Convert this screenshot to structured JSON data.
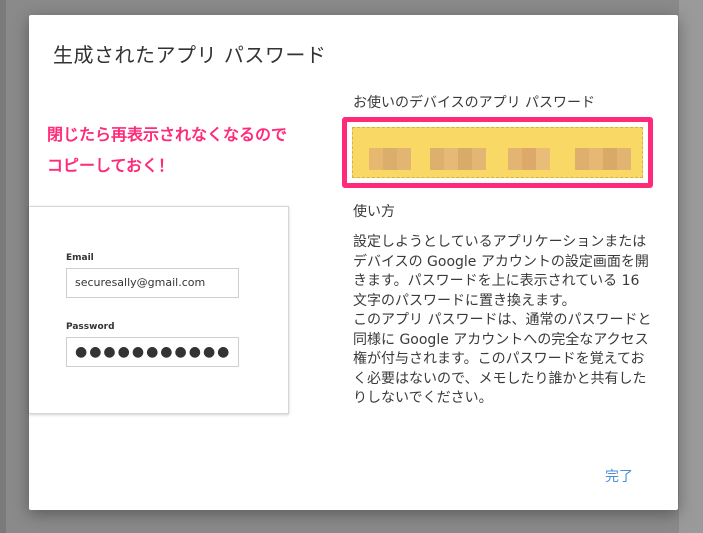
{
  "dialog": {
    "title": "生成されたアプリ パスワード",
    "device_password_heading": "お使いのデバイスのアプリ パスワード",
    "masked_password": "••••••••••••••••",
    "usage_heading": "使い方",
    "instructions": "設定しようとしているアプリケーションまたはデバイスの Google アカウントの設定画面を開きます。パスワードを上に表示されている 16 文字のパスワードに置き換えます。\nこのアプリ パスワードは、通常のパスワードと同様に Google アカウントへの完全なアクセス権が付与されます。このパスワードを覚えておく必要はないので、メモしたり誰かと共有したりしないでください。",
    "done_label": "完了"
  },
  "annotation": {
    "line1": "閉じたら再表示されなくなるので",
    "line2": "コピーしておく！"
  },
  "login_example": {
    "email_label": "Email",
    "email_value": "securesally@gmail.com",
    "password_label": "Password",
    "password_value": "●●●●●●●●●●●"
  },
  "colors": {
    "accent_pink": "#ff2a7a",
    "highlight_yellow": "#f9d865",
    "link_blue": "#4a8fd6"
  }
}
